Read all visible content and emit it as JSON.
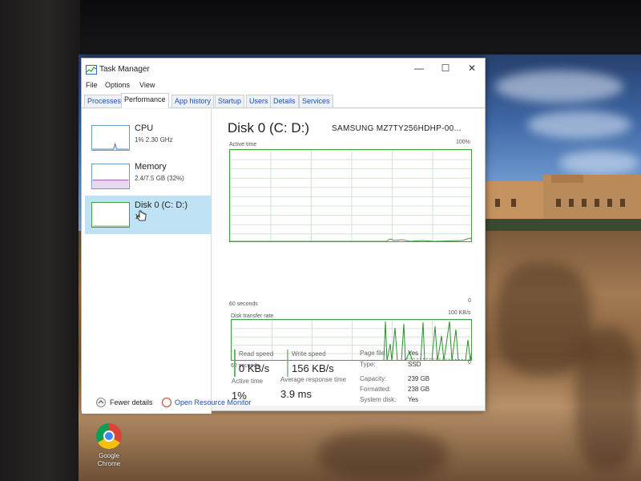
{
  "window": {
    "title": "Task Manager",
    "controls": {
      "minimize": "—",
      "maximize": "☐",
      "close": "✕"
    }
  },
  "menu": [
    "File",
    "Options",
    "View"
  ],
  "tabs": [
    {
      "label": "Processes",
      "active": false
    },
    {
      "label": "Performance",
      "active": true
    },
    {
      "label": "App history",
      "active": false
    },
    {
      "label": "Startup",
      "active": false
    },
    {
      "label": "Users",
      "active": false
    },
    {
      "label": "Details",
      "active": false
    },
    {
      "label": "Services",
      "active": false
    }
  ],
  "sidebar": {
    "items": [
      {
        "title": "CPU",
        "sub": "1% 2.30 GHz",
        "selected": false
      },
      {
        "title": "Memory",
        "sub": "2.4/7.5 GB (32%)",
        "selected": false
      },
      {
        "title": "Disk 0 (C: D:)",
        "sub": "1%",
        "selected": true
      }
    ]
  },
  "main": {
    "title": "Disk 0 (C: D:)",
    "model": "SAMSUNG MZ7TY256HDHP-00...",
    "active_graph": {
      "label": "Active time",
      "max": "100%",
      "time": "60 seconds",
      "min": "0"
    },
    "transfer_graph": {
      "label": "Disk transfer rate",
      "max": "100 KB/s",
      "time": "60 seconds",
      "min": "0"
    },
    "stats": {
      "active_time_label": "Active time",
      "active_time_value": "1%",
      "avg_response_label": "Average response time",
      "avg_response_value": "3.9 ms",
      "read_label": "Read speed",
      "read_value": "0 KB/s",
      "write_label": "Write speed",
      "write_value": "156 KB/s"
    },
    "properties": [
      {
        "label": "Capacity:",
        "value": "239 GB"
      },
      {
        "label": "Formatted:",
        "value": "238 GB"
      },
      {
        "label": "System disk:",
        "value": "Yes"
      },
      {
        "label": "Page file:",
        "value": "Yes"
      },
      {
        "label": "Type:",
        "value": "SSD"
      }
    ]
  },
  "footer": {
    "fewer_details": "Fewer details",
    "open_resource_monitor": "Open Resource Monitor"
  },
  "desktop": {
    "icon_label_1": "Google",
    "icon_label_2": "Chrome"
  },
  "colors": {
    "accent_link": "#1d4fa8",
    "graph_line": "#4a9c4a",
    "selected_bg": "#bfe3f5"
  }
}
